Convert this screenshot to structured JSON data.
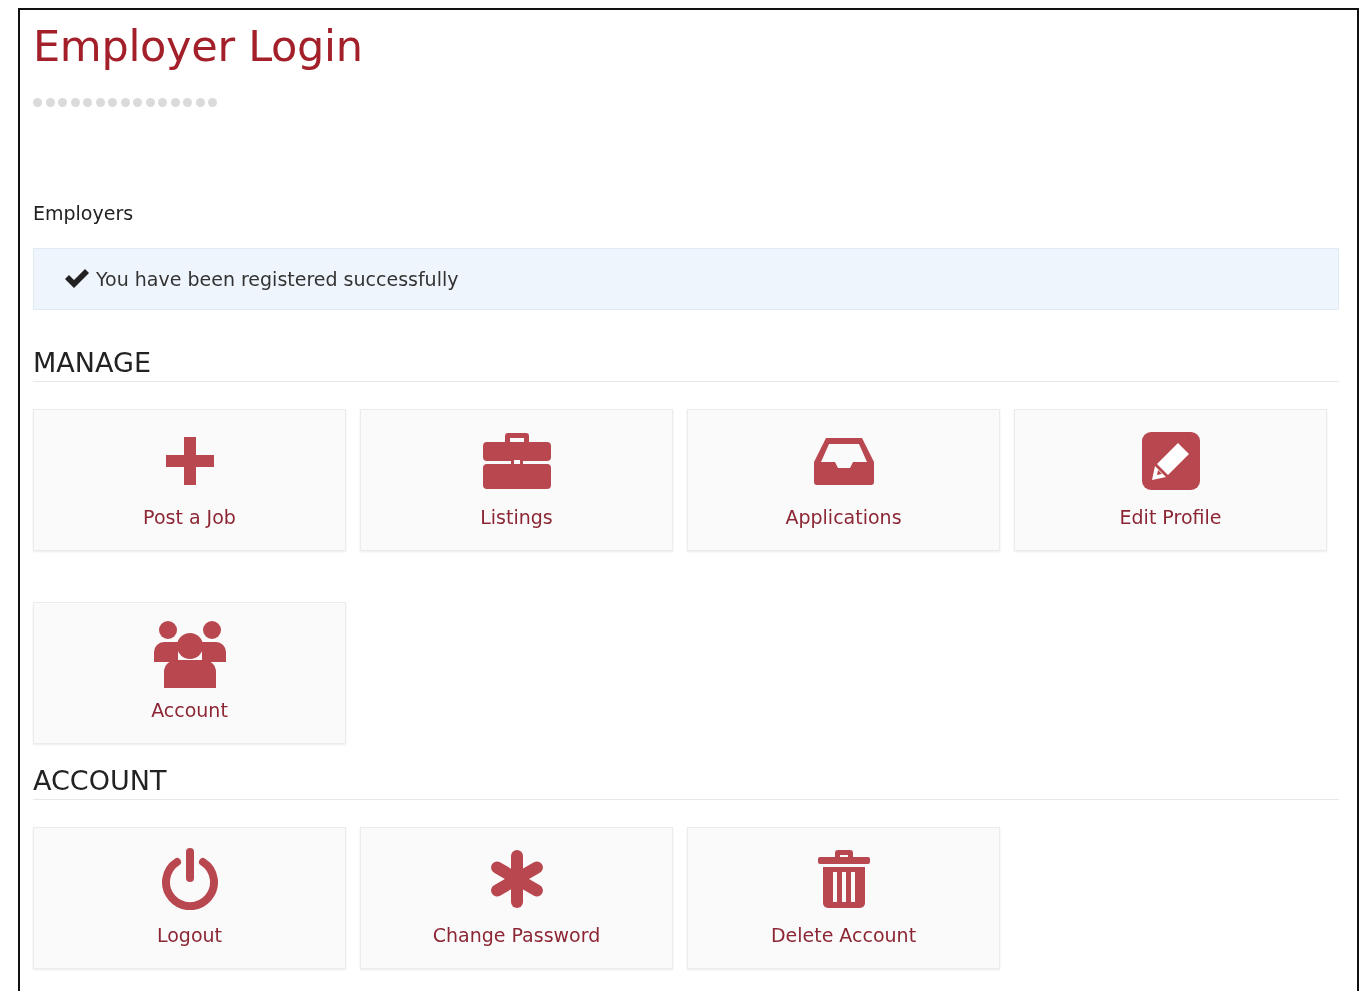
{
  "page": {
    "title": "Employer Login",
    "subtitle": "Employers"
  },
  "alert": {
    "message": "You have been registered successfully"
  },
  "sections": [
    {
      "heading": "MANAGE",
      "tiles": [
        {
          "label": "Post a Job",
          "kind": "plus"
        },
        {
          "label": "Listings",
          "kind": "briefcase"
        },
        {
          "label": "Applications",
          "kind": "inbox"
        },
        {
          "label": "Edit Profile",
          "kind": "edit"
        },
        {
          "label": "Account",
          "kind": "users"
        }
      ]
    },
    {
      "heading": "ACCOUNT",
      "tiles": [
        {
          "label": "Logout",
          "kind": "power"
        },
        {
          "label": "Change Password",
          "kind": "asterisk"
        },
        {
          "label": "Delete Account",
          "kind": "trash"
        }
      ]
    }
  ]
}
